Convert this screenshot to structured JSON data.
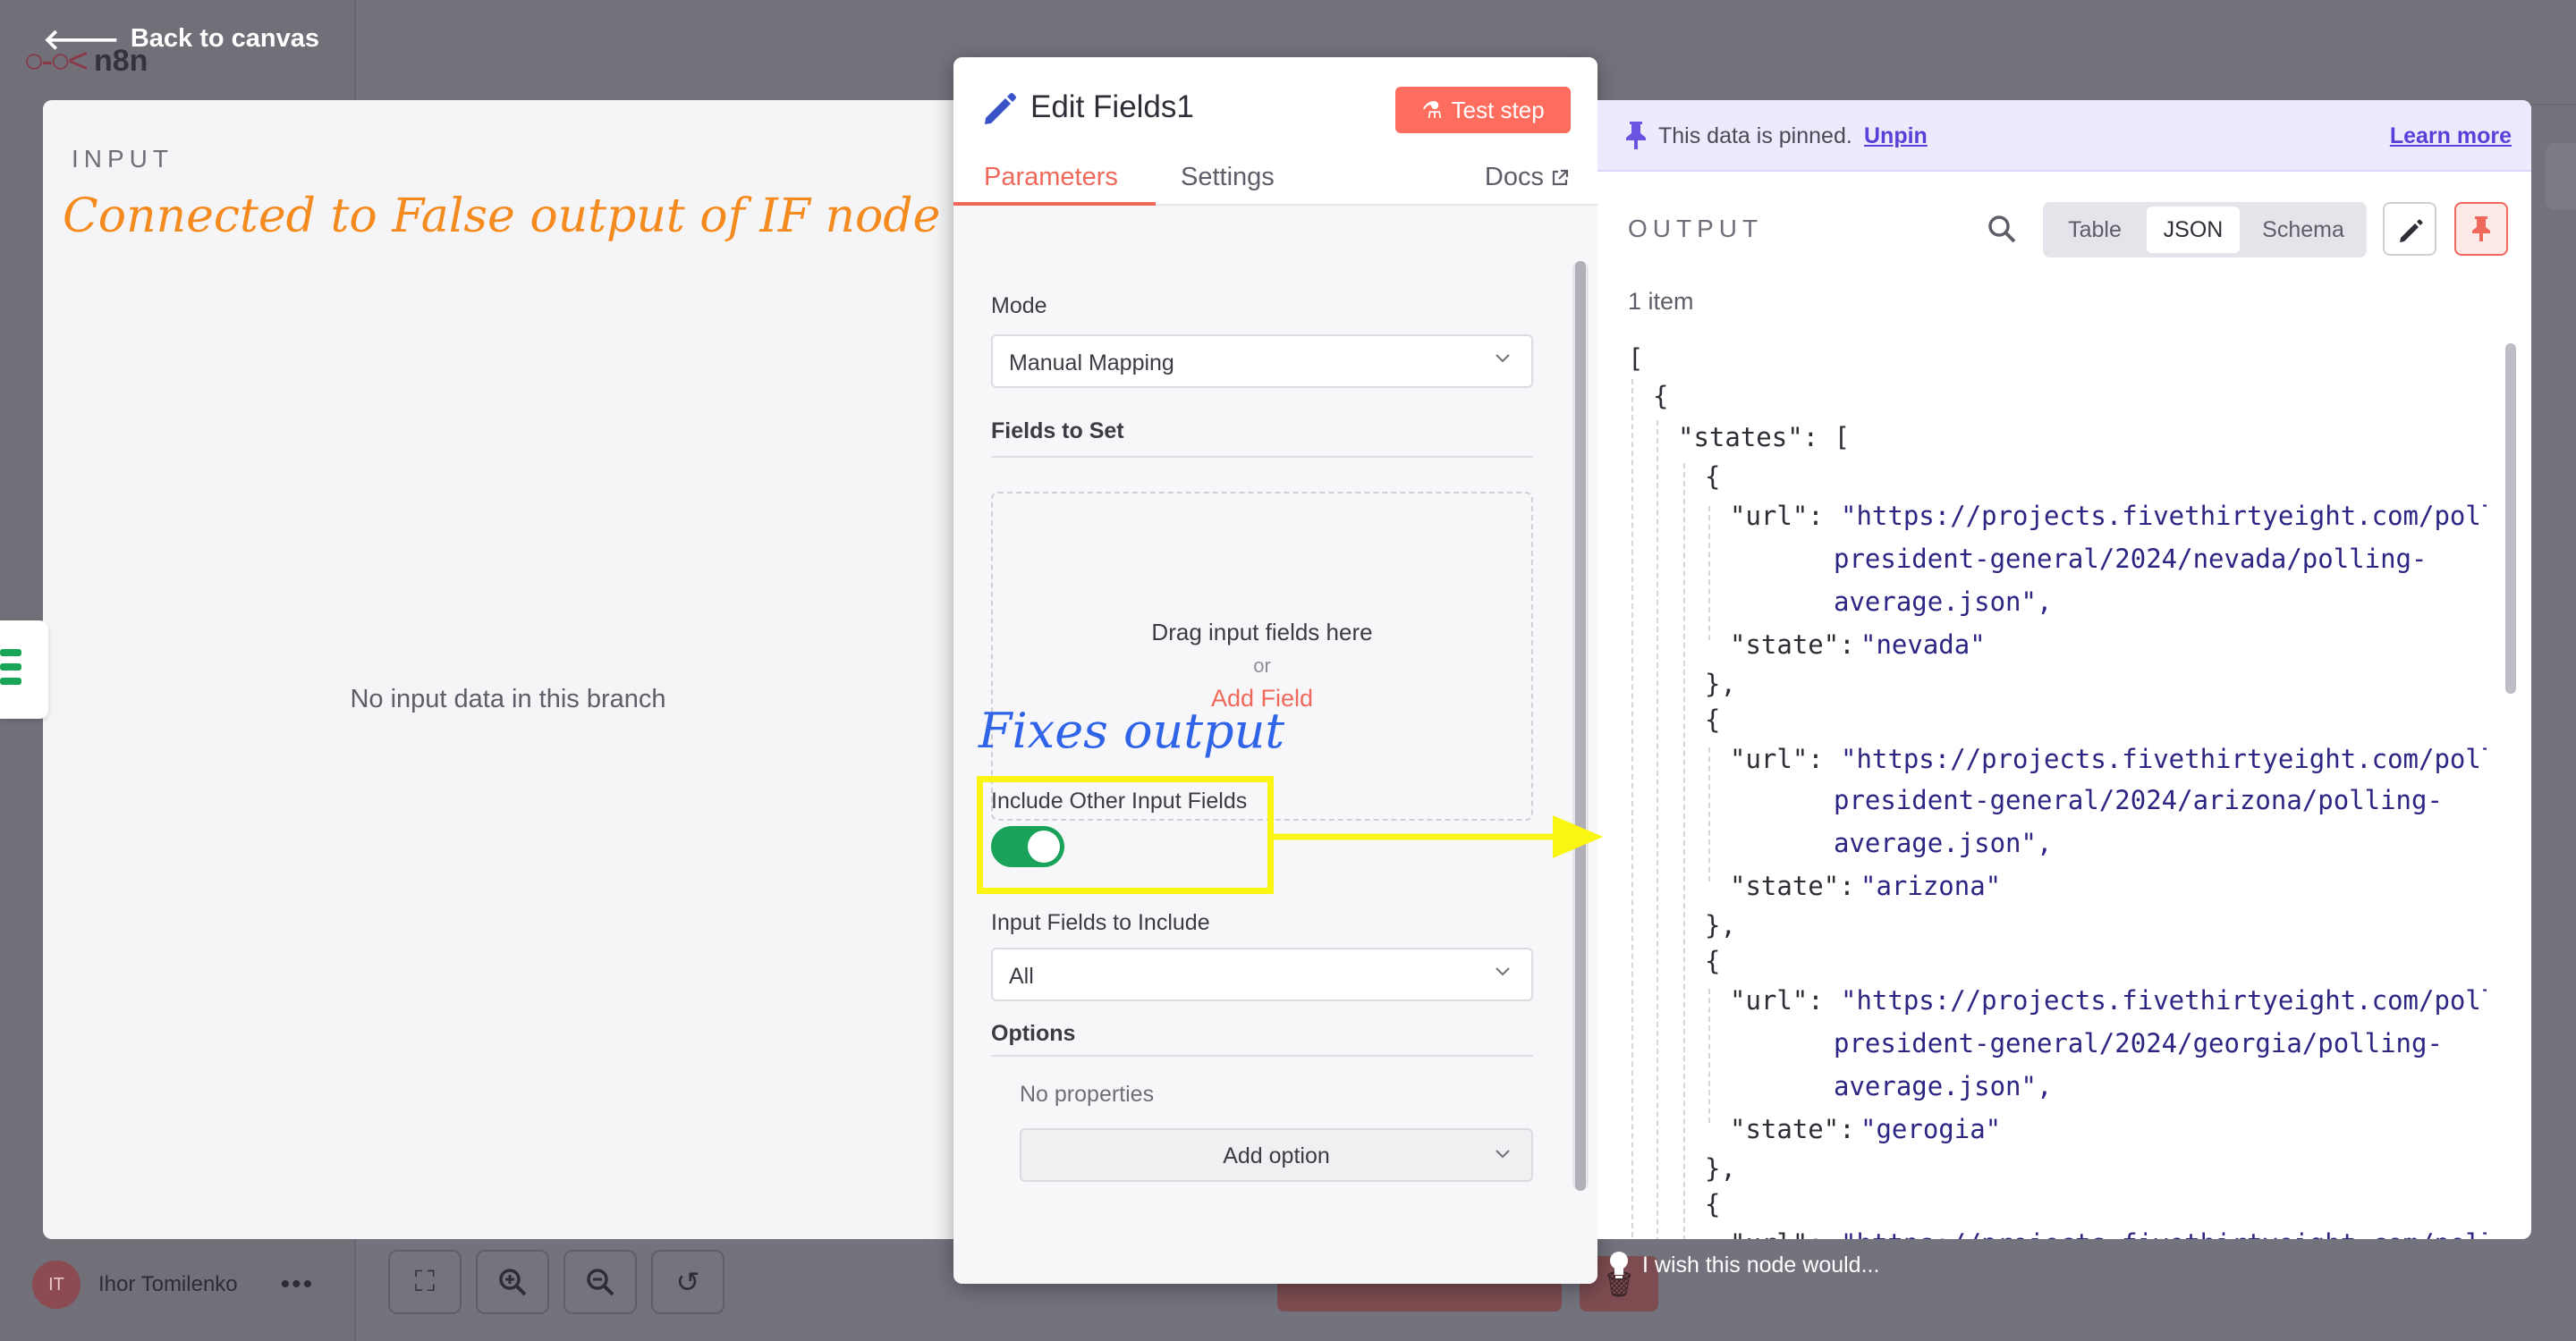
{
  "background": {
    "logo_text": "n8n",
    "user_initials": "IT",
    "user_name": "Ihor Tomilenko",
    "user_more": "•••"
  },
  "nav": {
    "back_label": "Back to canvas"
  },
  "input_panel": {
    "title": "INPUT",
    "empty_message": "No input data in this branch"
  },
  "annotations": {
    "top_note": "Connected to False output of IF node",
    "fix_note": "Fixes output",
    "highlight_color": "#fbf512"
  },
  "node": {
    "title": "Edit Fields1",
    "test_step_label": "Test step",
    "tabs": [
      {
        "label": "Parameters",
        "active": true
      },
      {
        "label": "Settings",
        "active": false
      }
    ],
    "docs_label": "Docs"
  },
  "params": {
    "mode_label": "Mode",
    "mode_value": "Manual Mapping",
    "fields_to_set_label": "Fields to Set",
    "dropzone_text": "Drag input fields here",
    "dropzone_or": "or",
    "add_field_label": "Add Field",
    "include_other_label": "Include Other Input Fields",
    "include_other_value": true,
    "input_fields_label": "Input Fields to Include",
    "input_fields_value": "All",
    "options_label": "Options",
    "no_properties": "No properties",
    "add_option_label": "Add option"
  },
  "output_panel": {
    "pinned_text": "This data is pinned.",
    "unpin_label": "Unpin",
    "learn_more_label": "Learn more",
    "title": "OUTPUT",
    "views": [
      {
        "label": "Table",
        "active": false
      },
      {
        "label": "JSON",
        "active": true
      },
      {
        "label": "Schema",
        "active": false
      }
    ],
    "item_count": "1 item",
    "json": {
      "open_array": "[",
      "open_obj": "{",
      "states_key": "\"states\": [",
      "items": [
        {
          "url_1": "\"https://projects.fivethirtyeight.com/polls/",
          "url_2": "president-general/2024/nevada/polling-",
          "url_3": "average.json\",",
          "state": "\"nevada\""
        },
        {
          "url_1": "\"https://projects.fivethirtyeight.com/polls/",
          "url_2": "president-general/2024/arizona/polling-",
          "url_3": "average.json\",",
          "state": "\"arizona\""
        },
        {
          "url_1": "\"https://projects.fivethirtyeight.com/polls/",
          "url_2": "president-general/2024/georgia/polling-",
          "url_3": "average.json\",",
          "state": "\"gerogia\""
        },
        {
          "url_1": "\"https://projects.fivethirtyeight.com/polls/"
        }
      ],
      "url_key": "\"url\":",
      "state_key": "\"state\":",
      "obj_open": "{",
      "obj_close": "},"
    }
  },
  "feedback": {
    "wish_text": "I wish this node would..."
  },
  "colors": {
    "accent": "#f0685a",
    "toggle_on": "#19a35a",
    "link": "#5a3fd8",
    "json_string": "#2c2583"
  }
}
